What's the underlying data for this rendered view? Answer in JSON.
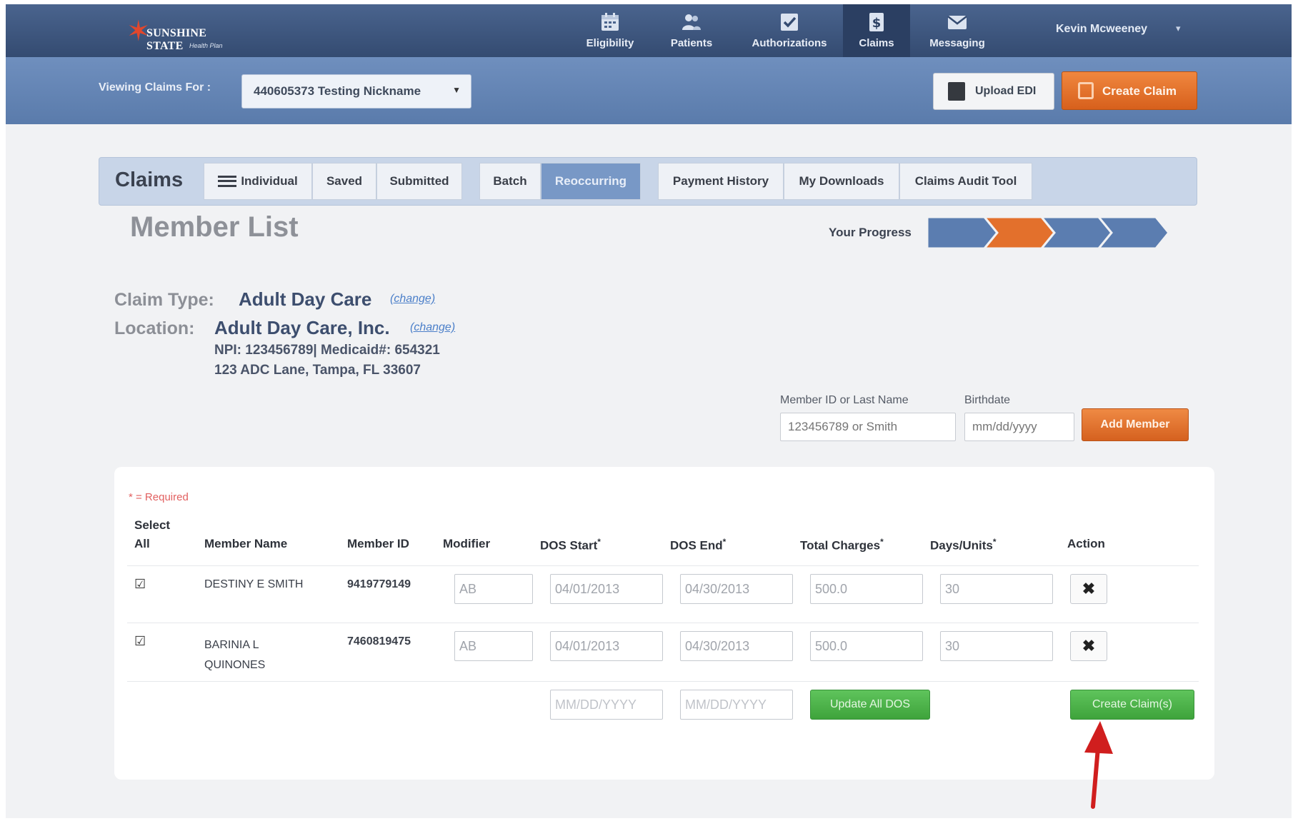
{
  "brand": {
    "name": "SUNSHINE STATE",
    "sub": "Health Plan"
  },
  "nav": {
    "items": [
      {
        "label": "Eligibility",
        "icon": "calendar-icon"
      },
      {
        "label": "Patients",
        "icon": "patients-icon"
      },
      {
        "label": "Authorizations",
        "icon": "checkbox-icon"
      },
      {
        "label": "Claims",
        "icon": "claims-icon",
        "active": true
      },
      {
        "label": "Messaging",
        "icon": "envelope-icon"
      }
    ],
    "user": "Kevin Mcweeney"
  },
  "subbar": {
    "viewing_label": "Viewing Claims For :",
    "viewing_value": "440605373 Testing Nickname",
    "upload_label": "Upload EDI",
    "create_label": "Create Claim"
  },
  "tabs": {
    "title": "Claims",
    "items": [
      {
        "label": "Individual"
      },
      {
        "label": "Saved"
      },
      {
        "label": "Submitted"
      },
      {
        "label": "Batch"
      },
      {
        "label": "Reoccurring",
        "active": true
      },
      {
        "label": "Payment History"
      },
      {
        "label": "My Downloads"
      },
      {
        "label": "Claims Audit Tool"
      }
    ]
  },
  "page": {
    "title": "Member List",
    "progress_label": "Your Progress",
    "progress_steps": 4,
    "progress_current": 2
  },
  "claim": {
    "type_key": "Claim Type:",
    "type_value": "Adult Day Care",
    "change": "(change)",
    "location_key": "Location:",
    "location_value": "Adult Day Care, Inc.",
    "npi_line": "NPI: 123456789| Medicaid#: 654321",
    "address": "123 ADC Lane, Tampa, FL 33607"
  },
  "search": {
    "member_label": "Member ID or Last Name",
    "member_placeholder": "123456789 or Smith",
    "birthdate_label": "Birthdate",
    "birthdate_placeholder": "mm/dd/yyyy",
    "add_label": "Add Member"
  },
  "table": {
    "required_note": "* = Required",
    "headers": {
      "select": "Select",
      "all": "All",
      "member_name": "Member Name",
      "member_id": "Member ID",
      "modifier": "Modifier",
      "dos_start": "DOS Start",
      "dos_end": "DOS End",
      "total_charges": "Total Charges",
      "days_units": "Days/Units",
      "action": "Action"
    },
    "rows": [
      {
        "checked": true,
        "name": "DESTINY E SMITH",
        "id": "9419779149",
        "modifier": "AB",
        "dos_start": "04/01/2013",
        "dos_end": "04/30/2013",
        "charges": "500.0",
        "units": "30"
      },
      {
        "checked": true,
        "name": "BARINIA L QUINONES",
        "id": "7460819475",
        "modifier": "AB",
        "dos_start": "04/01/2013",
        "dos_end": "04/30/2013",
        "charges": "500.0",
        "units": "30"
      }
    ],
    "footer": {
      "dos_start_placeholder": "MM/DD/YYYY",
      "dos_end_placeholder": "MM/DD/YYYY",
      "update_label": "Update All DOS",
      "create_label": "Create Claim(s)"
    }
  },
  "colors": {
    "nav": "#3d5680",
    "subbar": "#6585b5",
    "accent_orange": "#e3702c",
    "green": "#4cb349",
    "progress_blue": "#5b7db0",
    "progress_orange": "#e3702c",
    "arrow_red": "#d01e1e"
  }
}
